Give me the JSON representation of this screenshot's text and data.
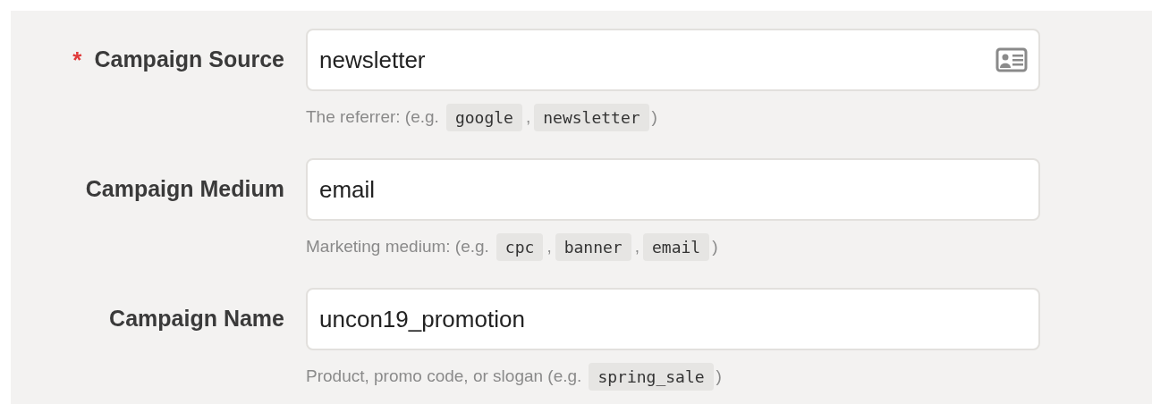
{
  "fields": [
    {
      "label": "Campaign Source",
      "required_mark": "*",
      "value": "newsletter",
      "contact_icon": true,
      "help": {
        "prefix": "The referrer: (e.g.",
        "examples": [
          "google",
          "newsletter"
        ],
        "separator": ",",
        "suffix": ")"
      }
    },
    {
      "label": "Campaign Medium",
      "value": "email",
      "contact_icon": false,
      "help": {
        "prefix": "Marketing medium: (e.g.",
        "examples": [
          "cpc",
          "banner",
          "email"
        ],
        "separator": ",",
        "suffix": ")"
      }
    },
    {
      "label": "Campaign Name",
      "value": "uncon19_promotion",
      "contact_icon": false,
      "help": {
        "prefix": "Product, promo code, or slogan (e.g.",
        "examples": [
          "spring_sale"
        ],
        "suffix": ")"
      }
    }
  ]
}
